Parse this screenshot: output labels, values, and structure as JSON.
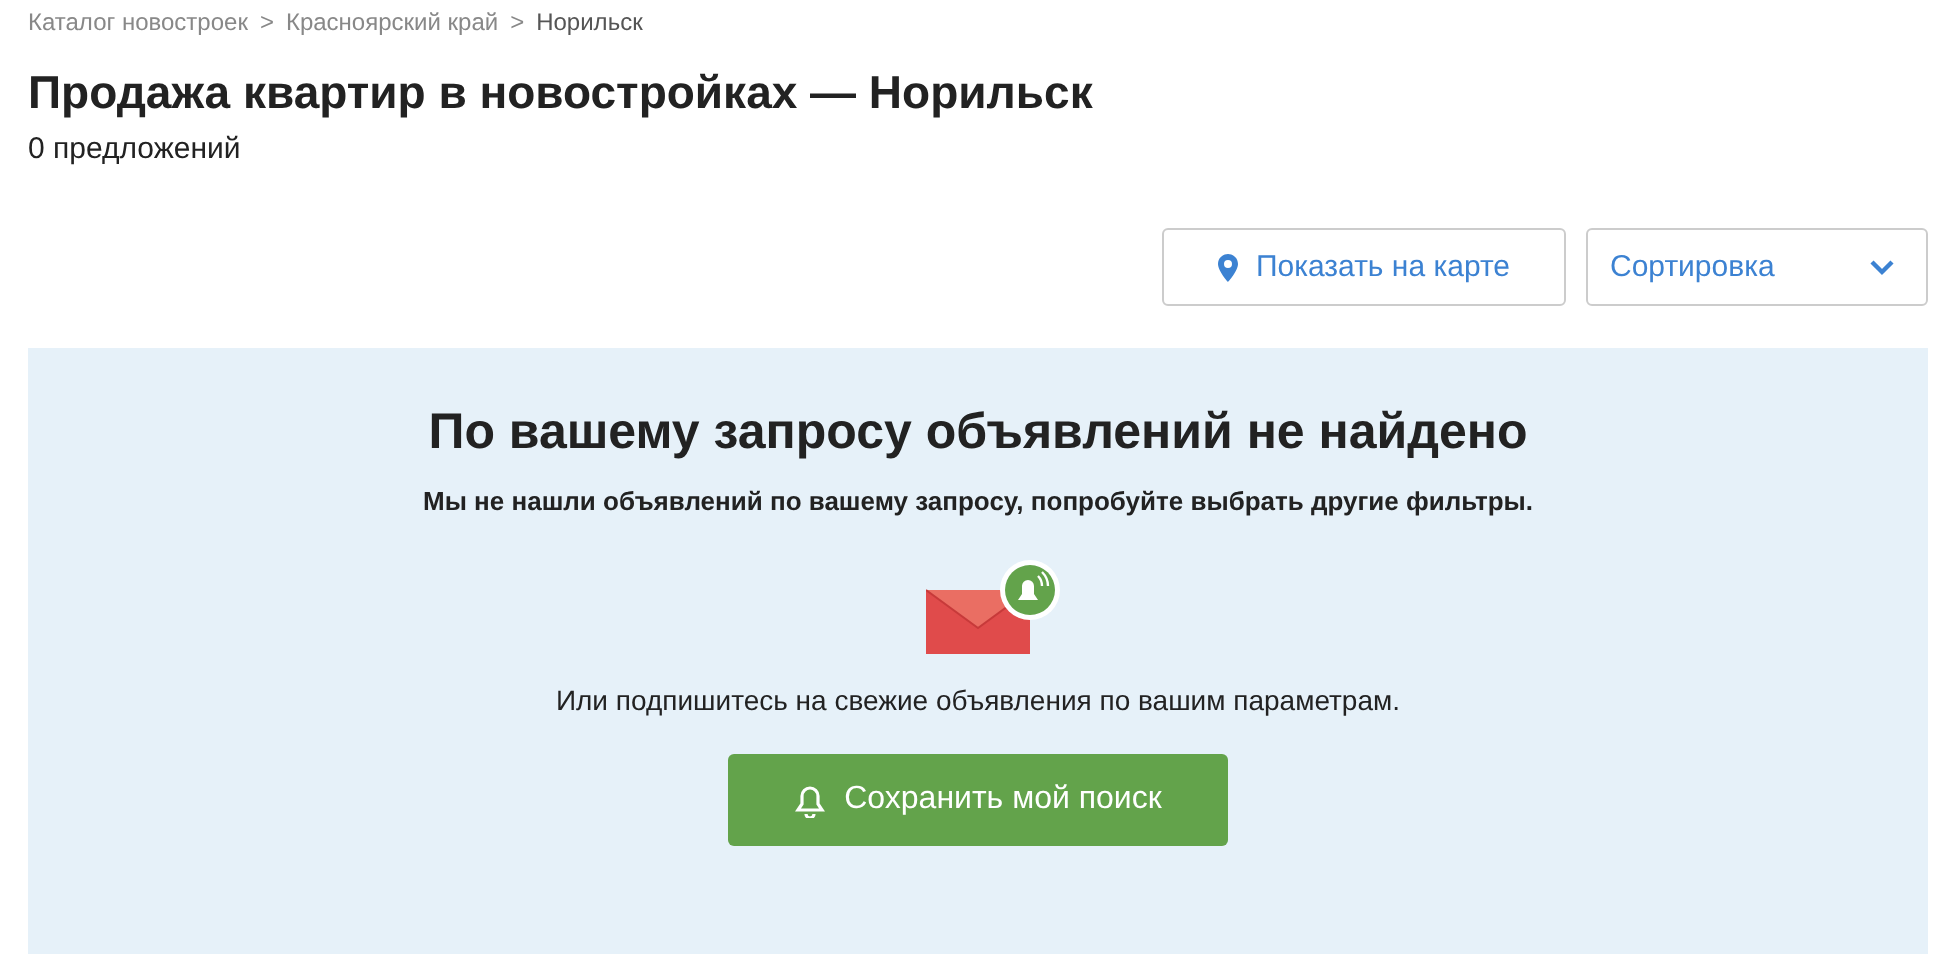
{
  "breadcrumbs": [
    {
      "label": "Каталог новостроек",
      "current": false
    },
    {
      "label": "Красноярский край",
      "current": false
    },
    {
      "label": "Норильск",
      "current": true
    }
  ],
  "breadcrumb_separator": ">",
  "title": "Продажа квартир в новостройках — Норильск",
  "count": "0 предложений",
  "toolbar": {
    "map_button": "Показать на карте",
    "sort": "Сортировка"
  },
  "empty": {
    "heading": "По вашему запросу объявлений не найдено",
    "subtitle": "Мы не нашли объявлений по вашему запросу, попробуйте выбрать другие фильтры.",
    "prompt": "Или подпишитесь на свежие объявления по вашим параметрам.",
    "button": "Сохранить мой поиск"
  }
}
